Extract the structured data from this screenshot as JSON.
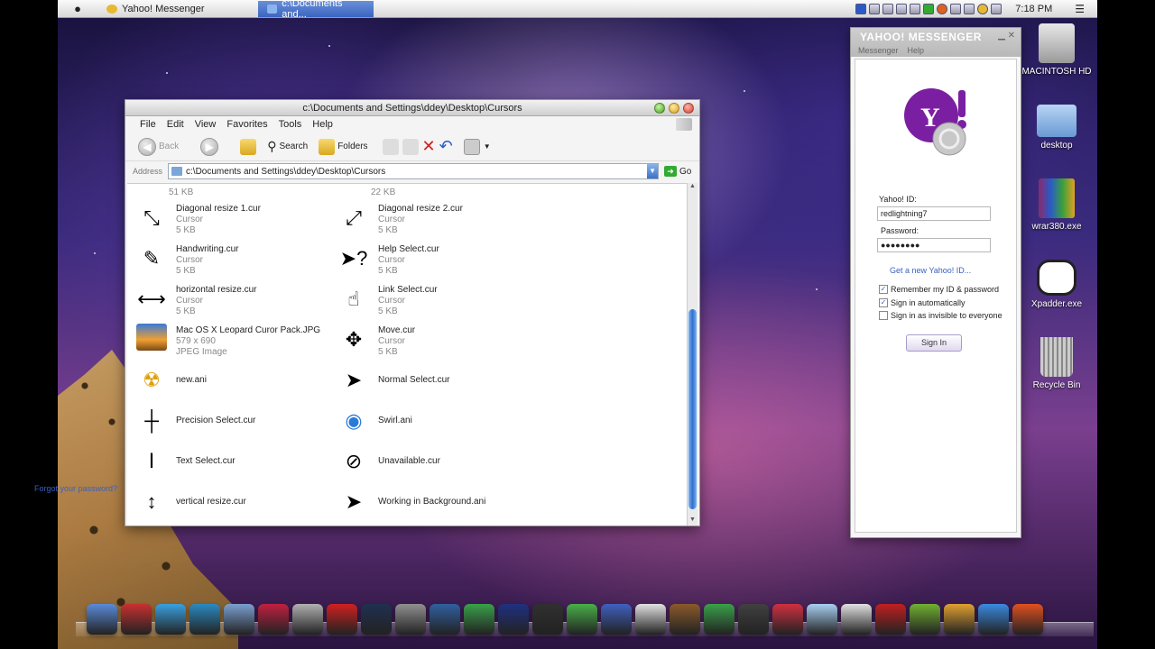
{
  "menubar": {
    "apple": "",
    "tabs": [
      {
        "label": "Yahoo! Messenger",
        "active": false,
        "color": "#e8b830"
      },
      {
        "label": "c:\\Documents and...",
        "active": true,
        "color": "#8ab4ec"
      }
    ],
    "clock": "7:18 PM",
    "list_glyph": "☰"
  },
  "explorer": {
    "title": "c:\\Documents and Settings\\ddey\\Desktop\\Cursors",
    "menu": [
      "File",
      "Edit",
      "View",
      "Favorites",
      "Tools",
      "Help"
    ],
    "toolbar": {
      "back": "Back",
      "search": "Search",
      "folders": "Folders"
    },
    "address": {
      "label": "Address",
      "value": "c:\\Documents and Settings\\ddey\\Desktop\\Cursors",
      "go": "Go"
    },
    "top_sizes": [
      "51 KB",
      "22 KB"
    ],
    "files": [
      {
        "name": "Diagonal resize 1.cur",
        "type": "Cursor",
        "size": "5 KB",
        "icon": "diagonal-resize-nw-icon",
        "glyph": "⤡"
      },
      {
        "name": "Diagonal resize 2.cur",
        "type": "Cursor",
        "size": "5 KB",
        "icon": "diagonal-resize-ne-icon",
        "glyph": "⤢"
      },
      {
        "name": "Handwriting.cur",
        "type": "Cursor",
        "size": "5 KB",
        "icon": "pen-icon",
        "glyph": "✎"
      },
      {
        "name": "Help Select.cur",
        "type": "Cursor",
        "size": "5 KB",
        "icon": "help-cursor-icon",
        "glyph": "➤?"
      },
      {
        "name": "horizontal resize.cur",
        "type": "Cursor",
        "size": "5 KB",
        "icon": "horizontal-resize-icon",
        "glyph": "⟷"
      },
      {
        "name": "Link Select.cur",
        "type": "Cursor",
        "size": "5 KB",
        "icon": "hand-pointer-icon",
        "glyph": "☝"
      },
      {
        "name": "Mac OS X Leopard Curor Pack.JPG",
        "type": "579 x 690",
        "size": "JPEG Image",
        "icon": "image-file-icon",
        "glyph": ""
      },
      {
        "name": "Move.cur",
        "type": "Cursor",
        "size": "5 KB",
        "icon": "move-icon",
        "glyph": "✥"
      },
      {
        "name": "new.ani",
        "type": "",
        "size": "",
        "icon": "radiation-icon",
        "glyph": "☢"
      },
      {
        "name": "Normal Select.cur",
        "type": "",
        "size": "",
        "icon": "arrow-cursor-icon",
        "glyph": "➤"
      },
      {
        "name": "Precision Select.cur",
        "type": "",
        "size": "",
        "icon": "crosshair-icon",
        "glyph": "┼"
      },
      {
        "name": "Swirl.ani",
        "type": "",
        "size": "",
        "icon": "spinner-icon",
        "glyph": "◉"
      },
      {
        "name": "Text Select.cur",
        "type": "",
        "size": "",
        "icon": "text-cursor-icon",
        "glyph": "Ⅰ"
      },
      {
        "name": "Unavailable.cur",
        "type": "",
        "size": "",
        "icon": "unavailable-icon",
        "glyph": "⊘"
      },
      {
        "name": "vertical resize.cur",
        "type": "",
        "size": "",
        "icon": "vertical-resize-icon",
        "glyph": "↕"
      },
      {
        "name": "Working in Background.ani",
        "type": "",
        "size": "",
        "icon": "working-background-icon",
        "glyph": "➤"
      }
    ]
  },
  "yahoo": {
    "brand": "YAHOO! MESSENGER",
    "menu": [
      "Messenger",
      "Help"
    ],
    "id_label": "Yahoo! ID:",
    "id_value": "redlightning7",
    "password_label": "Password:",
    "password_value": "●●●●●●●●",
    "get_id_link": "Get a new Yahoo! ID...",
    "checkboxes": [
      {
        "label": "Remember my ID & password",
        "checked": true
      },
      {
        "label": "Sign in automatically",
        "checked": true
      },
      {
        "label": "Sign in as invisible to everyone",
        "checked": false
      }
    ],
    "signin": "Sign In",
    "forgot": "Forgot your password?",
    "brand_color": "#7b1fa2"
  },
  "desktop_icons": [
    {
      "label": "MACINTOSH HD",
      "icon": "hard-drive-icon"
    },
    {
      "label": "desktop",
      "icon": "folder-icon"
    },
    {
      "label": "wrar380.exe",
      "icon": "winrar-icon"
    },
    {
      "label": "Xpadder.exe",
      "icon": "gamepad-icon"
    },
    {
      "label": "Recycle Bin",
      "icon": "trash-icon"
    }
  ],
  "dock_colors": [
    "#5a8ad8",
    "#c83030",
    "#3aa0e0",
    "#2a8ac0",
    "#7aa0d0",
    "#c02040",
    "#b0b0b0",
    "#d02020",
    "#203050",
    "#909090",
    "#3060a0",
    "#3aa04a",
    "#203080",
    "#303030",
    "#48b048",
    "#4060c0",
    "#e0e0e0",
    "#8a5a2a",
    "#3aa04a",
    "#404040",
    "#d03040",
    "#a8d0f0",
    "#e0e0e0",
    "#c02020",
    "#70b030",
    "#e0a030",
    "#3a8ae0",
    "#e05020"
  ]
}
